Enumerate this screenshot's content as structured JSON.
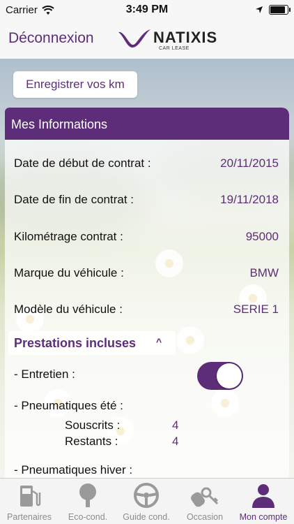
{
  "status_bar": {
    "carrier": "Carrier",
    "time": "3:49 PM"
  },
  "nav": {
    "logout_label": "Déconnexion",
    "logo_brand": "NATIXIS",
    "logo_sub": "CAR LEASE"
  },
  "record_km_button": "Enregistrer vos km",
  "info": {
    "title": "Mes Informations",
    "rows": [
      {
        "label": "Date de début de contrat :",
        "value": "20/11/2015"
      },
      {
        "label": "Date de fin de contrat :",
        "value": "19/11/2018"
      },
      {
        "label": "Kilométrage contrat :",
        "value": "95000"
      },
      {
        "label": "Marque du véhicule :",
        "value": "BMW"
      },
      {
        "label": "Modèle du véhicule :",
        "value": "SERIE 1"
      }
    ]
  },
  "prestations": {
    "header": "Prestations incluses",
    "chevron": "^",
    "entretien_label": "- Entretien :",
    "entretien_on": true,
    "pneu_ete_label": "- Pneumatiques été :",
    "souscrits_label": "Souscrits :",
    "souscrits_value": "4",
    "restants_label": "Restants :",
    "restants_value": "4",
    "pneu_hiver_label": "- Pneumatiques hiver :"
  },
  "tabs": [
    {
      "label": "Partenaires",
      "icon": "fuel-pump-icon",
      "active": false
    },
    {
      "label": "Eco-cond.",
      "icon": "tree-icon",
      "active": false
    },
    {
      "label": "Guide cond.",
      "icon": "steering-wheel-icon",
      "active": false
    },
    {
      "label": "Occasion",
      "icon": "car-keys-icon",
      "active": false
    },
    {
      "label": "Mon compte",
      "icon": "user-icon",
      "active": true
    }
  ],
  "colors": {
    "brand_purple": "#5e2d79",
    "tab_inactive": "#8c8c8c"
  }
}
